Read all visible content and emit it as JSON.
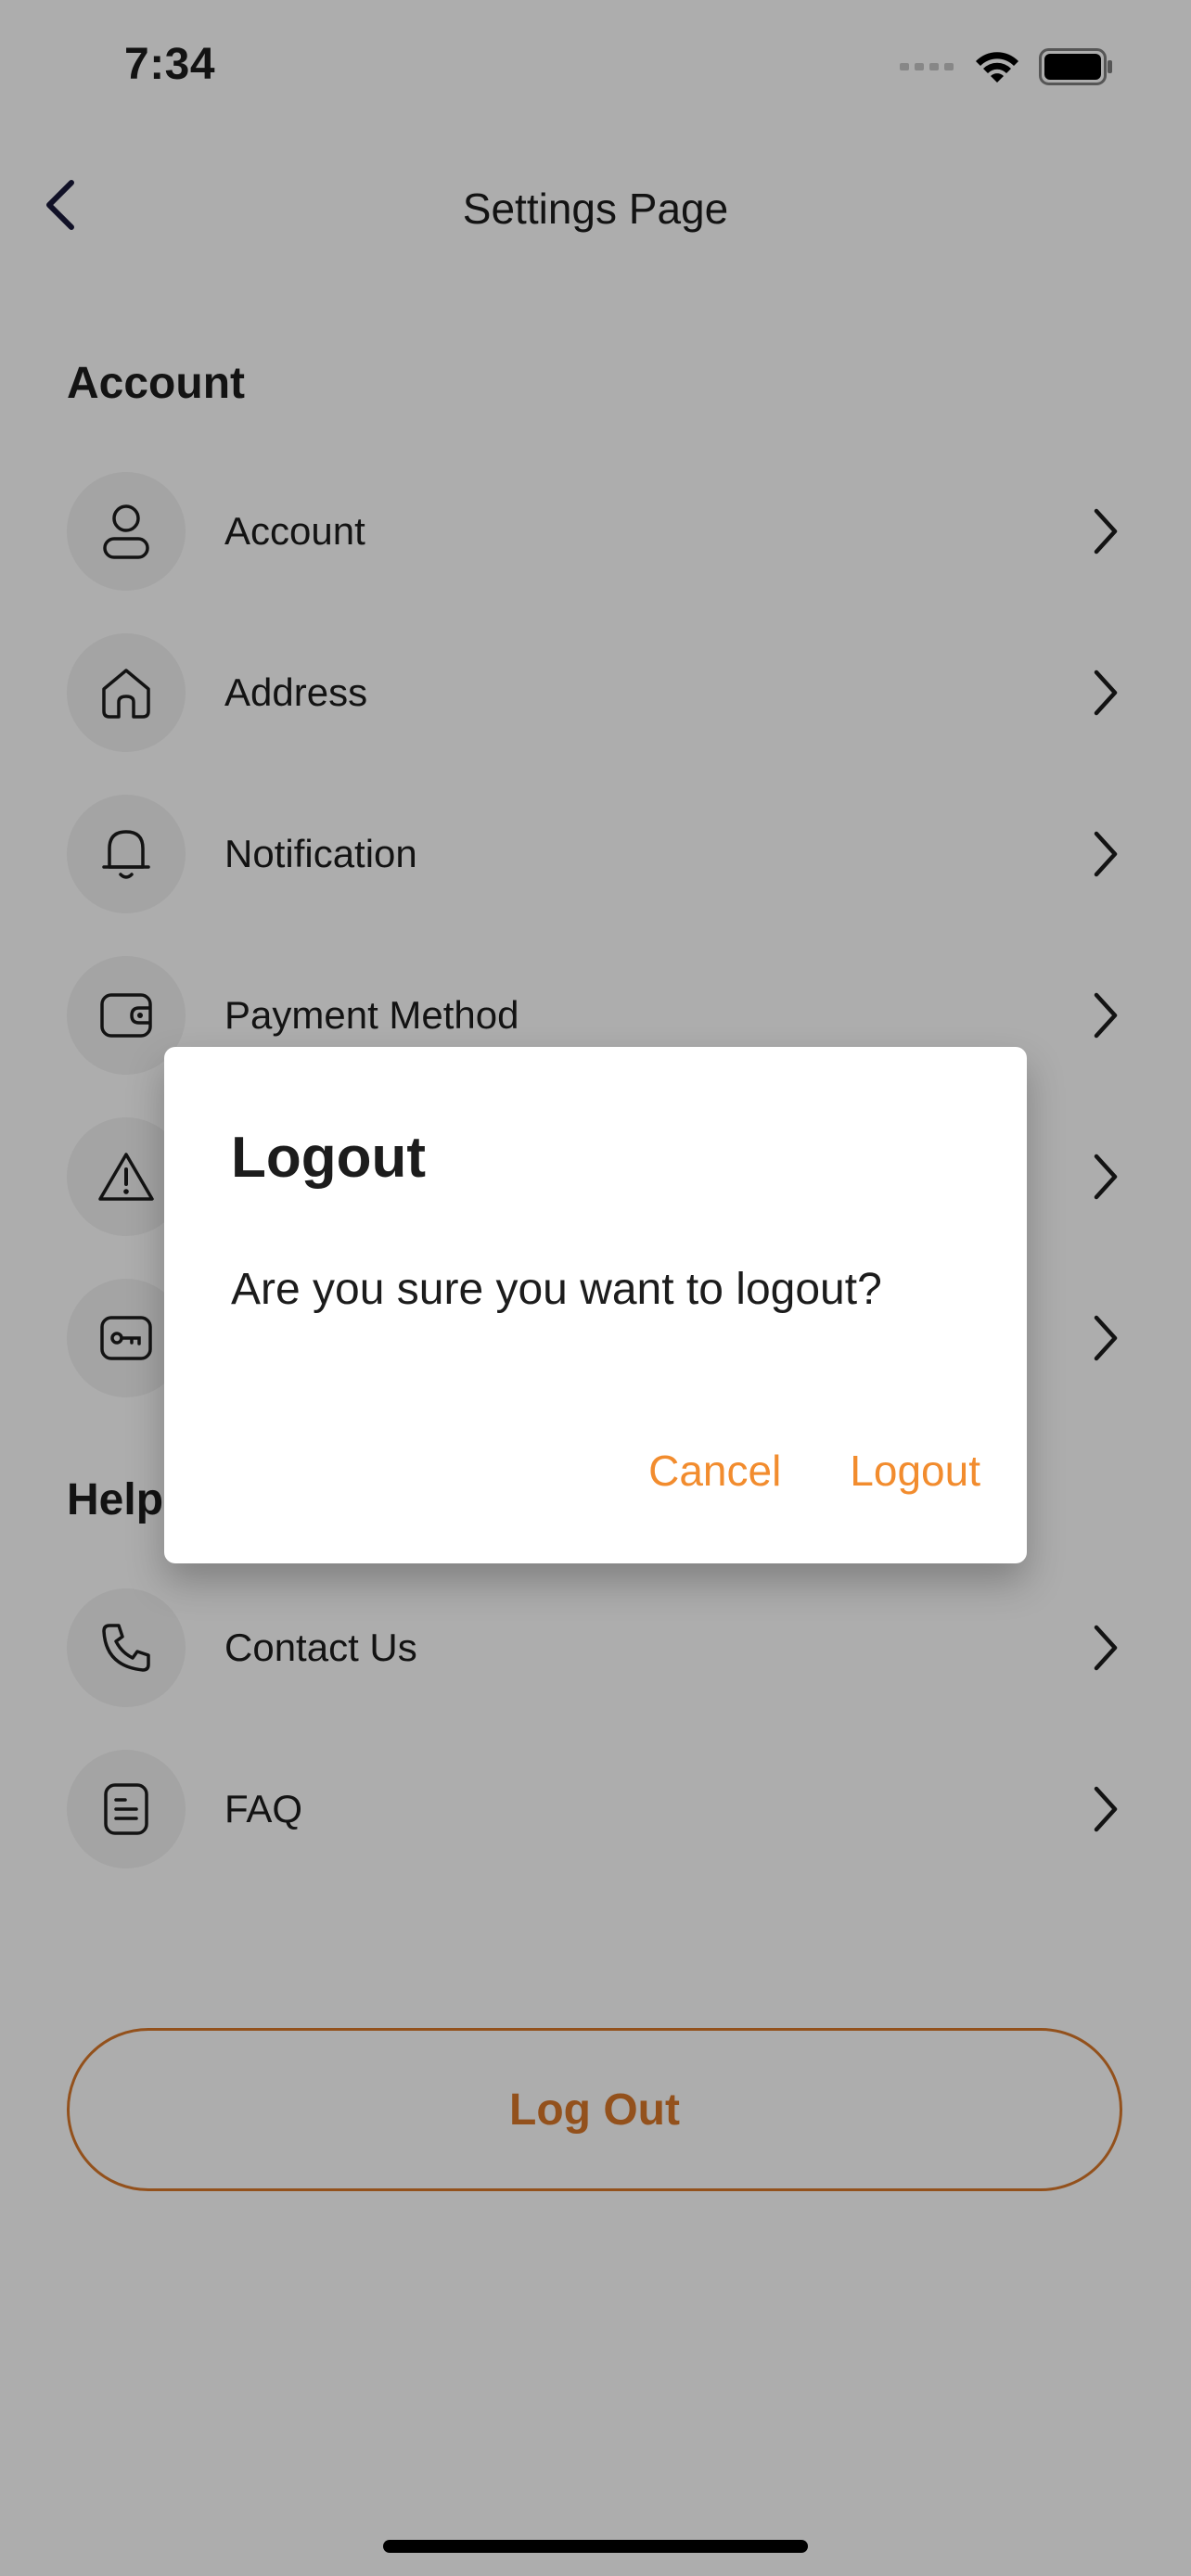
{
  "status_bar": {
    "time": "7:34"
  },
  "header": {
    "title": "Settings Page"
  },
  "sections": {
    "account": {
      "title": "Account",
      "items": [
        {
          "label": "Account",
          "icon": "user-icon"
        },
        {
          "label": "Address",
          "icon": "home-icon"
        },
        {
          "label": "Notification",
          "icon": "bell-icon"
        },
        {
          "label": "Payment Method",
          "icon": "wallet-icon"
        },
        {
          "label": "",
          "icon": "warning-icon"
        },
        {
          "label": "",
          "icon": "key-icon"
        }
      ]
    },
    "help": {
      "title": "Help",
      "items": [
        {
          "label": "Contact Us",
          "icon": "phone-icon"
        },
        {
          "label": "FAQ",
          "icon": "document-icon"
        }
      ]
    }
  },
  "logout_button": {
    "label": "Log Out"
  },
  "dialog": {
    "title": "Logout",
    "message": "Are you sure you want to logout?",
    "cancel_label": "Cancel",
    "confirm_label": "Logout"
  },
  "colors": {
    "accent": "#f28c2e",
    "logout_outline": "#d9782a",
    "icon_bg": "#f2f2f2",
    "scrim": "rgba(0,0,0,0.32)"
  }
}
